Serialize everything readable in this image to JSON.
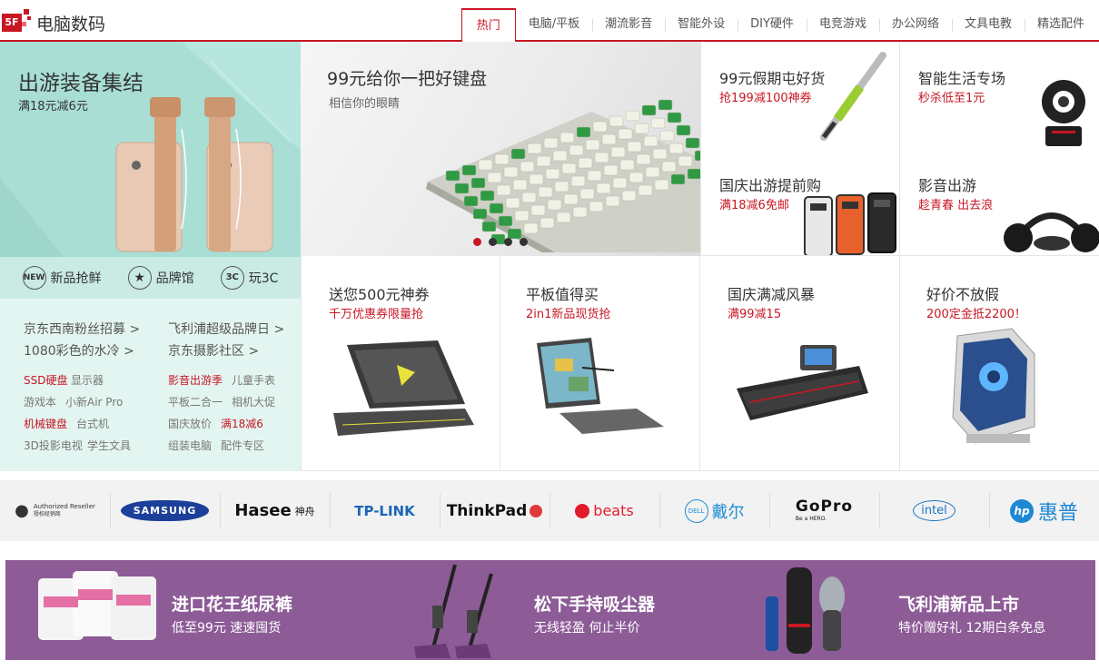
{
  "floor": {
    "number": "5F",
    "title": "电脑数码"
  },
  "tabs": [
    "热门",
    "电脑/平板",
    "潮流影音",
    "智能外设",
    "DIY硬件",
    "电竞游戏",
    "办公网络",
    "文具电教",
    "精选配件"
  ],
  "left_banner": {
    "title": "出游装备集结",
    "subtitle": "满18元减6元"
  },
  "quick_links": [
    {
      "icon": "new-icon",
      "icon_text": "NEW",
      "label": "新品抢鲜"
    },
    {
      "icon": "star-icon",
      "icon_text": "★",
      "label": "品牌馆"
    },
    {
      "icon": "3c-icon",
      "icon_text": "3C",
      "label": "玩3C"
    }
  ],
  "left_links": {
    "big": [
      "京东西南粉丝招募 >",
      "飞利浦超级品牌日 >",
      "1080彩色的水冷 >",
      "京东摄影社区 >"
    ],
    "small": [
      [
        "SSD硬盘",
        "显示器",
        "影音出游季",
        "儿童手表"
      ],
      [
        "游戏本",
        "小新Air Pro",
        "平板二合一",
        "相机大促"
      ],
      [
        "机械键盘",
        "台式机",
        "国庆放价",
        "满18减6"
      ],
      [
        "3D投影电视",
        "学生文具",
        "组装电脑",
        "配件专区"
      ]
    ]
  },
  "center_banner": {
    "title": "99元给你一把好键盘",
    "subtitle": "相信你的眼睛",
    "slide_count": 4,
    "active_slide": 1
  },
  "top_cells": [
    {
      "title": "99元假期屯好货",
      "sub": "抢199减100神券",
      "product": "pen"
    },
    {
      "title": "智能生活专场",
      "sub": "秒杀低至1元",
      "product": "camera"
    },
    {
      "title": "国庆出游提前购",
      "sub": "满18减6免邮",
      "product": "phone-cases"
    },
    {
      "title": "影音出游",
      "sub": "趁青春 出去浪",
      "product": "headphones"
    }
  ],
  "bottom_cells": [
    {
      "title": "送您500元神券",
      "sub": "千万优惠券限量抢",
      "product": "laptop"
    },
    {
      "title": "平板值得买",
      "sub": "2in1新品现货抢",
      "product": "tablet"
    },
    {
      "title": "国庆满减风暴",
      "sub": "满99减15",
      "product": "gaming-keyboard"
    },
    {
      "title": "好价不放假",
      "sub": "200定金抵2200！",
      "product": "pc-case"
    }
  ],
  "brands": [
    {
      "name": "apple",
      "text": "Authorized Reseller",
      "sub": "授权经销商"
    },
    {
      "name": "samsung",
      "text": "SAMSUNG"
    },
    {
      "name": "hasee",
      "text": "Hasee",
      "sub": "神舟"
    },
    {
      "name": "tp-link",
      "text": "TP-LINK"
    },
    {
      "name": "thinkpad",
      "text": "ThinkPad"
    },
    {
      "name": "beats",
      "text": "beats"
    },
    {
      "name": "dell",
      "text": "DELL",
      "sub": "戴尔"
    },
    {
      "name": "gopro",
      "text": "GoPro",
      "sub": "Be a HERO."
    },
    {
      "name": "intel",
      "text": "intel"
    },
    {
      "name": "hp",
      "text": "hp",
      "sub": "惠普"
    }
  ],
  "promos": [
    {
      "title": "进口花王纸尿裤",
      "sub": "低至99元   速速囤货"
    },
    {
      "title": "松下手持吸尘器",
      "sub": "无线轻盈   何止半价"
    },
    {
      "title": "飞利浦新品上市",
      "sub": "特价赠好礼   12期白条免息"
    }
  ],
  "colors": {
    "accent": "#c81623",
    "teal": "#a9ded5",
    "promo": "#8d5c97"
  }
}
